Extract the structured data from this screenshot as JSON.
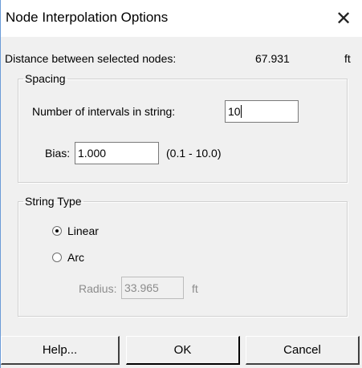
{
  "window": {
    "title": "Node Interpolation Options",
    "close_glyph": "✕"
  },
  "distance": {
    "label": "Distance between selected nodes:",
    "value": "67.931",
    "unit": "ft"
  },
  "spacing": {
    "legend": "Spacing",
    "intervals_label": "Number of intervals in string:",
    "intervals_value": "10",
    "bias_label": "Bias:",
    "bias_value": "1.000",
    "bias_range": "(0.1 - 10.0)"
  },
  "string_type": {
    "legend": "String Type",
    "options": [
      {
        "label": "Linear",
        "selected": true
      },
      {
        "label": "Arc",
        "selected": false
      }
    ],
    "radius_label": "Radius:",
    "radius_value": "33.965",
    "radius_unit": "ft"
  },
  "buttons": {
    "help": "Help...",
    "ok": "OK",
    "cancel": "Cancel"
  }
}
